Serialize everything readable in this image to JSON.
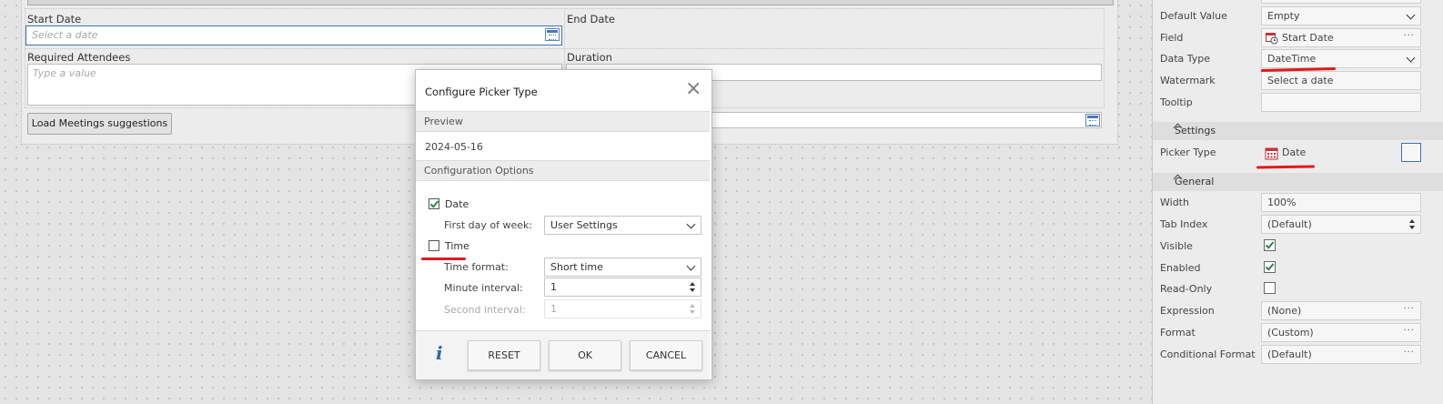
{
  "form": {
    "start_date": {
      "label": "Start Date",
      "placeholder": "Select a date"
    },
    "end_date": {
      "label": "End Date"
    },
    "required_attendees": {
      "label": "Required Attendees",
      "placeholder": "Type a value"
    },
    "duration": {
      "label": "Duration"
    },
    "load_button": "Load Meetings suggestions"
  },
  "dialog": {
    "title": "Configure Picker Type",
    "close_icon": "×",
    "preview_header": "Preview",
    "preview_value": "2024-05-16",
    "config_header": "Configuration Options",
    "date_checkbox": {
      "label": "Date",
      "checked": true
    },
    "first_day": {
      "label": "First day of week:",
      "value": "User Settings"
    },
    "time_checkbox": {
      "label": "Time",
      "checked": false
    },
    "time_format": {
      "label": "Time format:",
      "value": "Short time"
    },
    "minute_interval": {
      "label": "Minute interval:",
      "value": "1"
    },
    "second_interval": {
      "label": "Second interval:",
      "value": "1"
    },
    "info_icon": "i",
    "buttons": {
      "reset": "RESET",
      "ok": "OK",
      "cancel": "CANCEL"
    }
  },
  "properties": {
    "default_value": {
      "label": "Default Value",
      "value": "Empty"
    },
    "field": {
      "label": "Field",
      "value": "Start Date"
    },
    "data_type": {
      "label": "Data Type",
      "value": "DateTime"
    },
    "watermark": {
      "label": "Watermark",
      "value": "Select a date"
    },
    "tooltip": {
      "label": "Tooltip",
      "value": ""
    },
    "settings_header": "Settings",
    "picker_type": {
      "label": "Picker Type",
      "value": "Date"
    },
    "general_header": "General",
    "width": {
      "label": "Width",
      "value": "100%"
    },
    "tab_index": {
      "label": "Tab Index",
      "value": "(Default)"
    },
    "visible": {
      "label": "Visible",
      "checked": true
    },
    "enabled": {
      "label": "Enabled",
      "checked": true
    },
    "read_only": {
      "label": "Read-Only",
      "checked": false
    },
    "expression": {
      "label": "Expression",
      "value": "(None)"
    },
    "format": {
      "label": "Format",
      "value": "(Custom)"
    },
    "conditional_format": {
      "label": "Conditional Format",
      "value": "(Default)"
    },
    "ellipsis": "···"
  },
  "colors": {
    "annotation": "#e01b1b",
    "accent": "#2b6aa8"
  }
}
